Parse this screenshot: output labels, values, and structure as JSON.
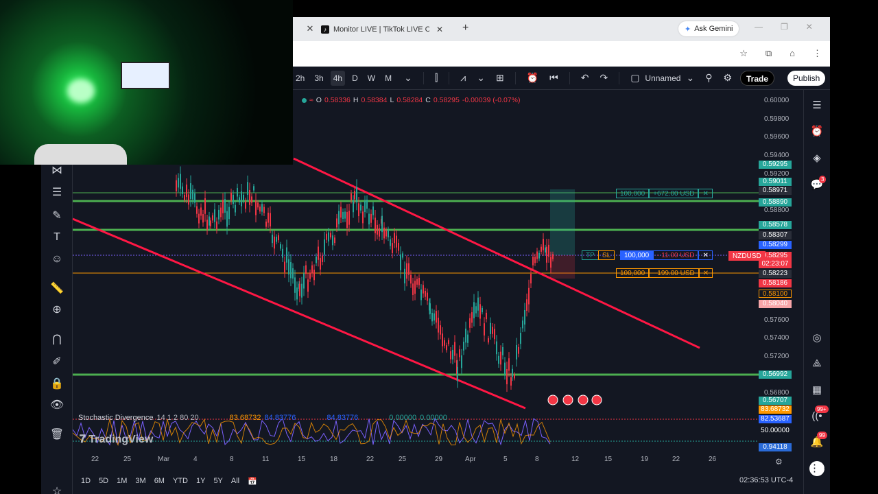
{
  "browser": {
    "tab_title": "Monitor LIVE | TikTok LIVE Cent",
    "gemini_label": "Ask Gemini"
  },
  "toolbar": {
    "intervals": [
      "2h",
      "3h",
      "4h",
      "D",
      "W",
      "M"
    ],
    "active_interval": "4h",
    "layout_name": "Unnamed",
    "trade_label": "Trade",
    "publish_label": "Publish"
  },
  "ohlc": {
    "open_label": "O",
    "open": "0.58336",
    "high_label": "H",
    "high": "0.58384",
    "low_label": "L",
    "low": "0.58284",
    "close_label": "C",
    "close": "0.58295",
    "change": "-0.00039 (-0.07%)"
  },
  "price_scale": [
    "0.60000",
    "0.59800",
    "0.59600",
    "0.59400",
    "0.59200",
    "0.58800",
    "0.57600",
    "0.57400",
    "0.57200",
    "0.56800"
  ],
  "price_tags": [
    {
      "value": "0.59295",
      "color": "#26a69a"
    },
    {
      "value": "0.59011",
      "color": "#26a69a"
    },
    {
      "value": "0.58971",
      "color": "#2a2e39"
    },
    {
      "value": "0.58890",
      "color": "#26a69a"
    },
    {
      "value": "0.58578",
      "color": "#26a69a"
    },
    {
      "value": "0.58307",
      "color": "#2a2e39"
    },
    {
      "value": "0.58299",
      "color": "#2962ff"
    },
    {
      "value": "0.58295",
      "color": "#f23645"
    },
    {
      "value": "02:23:07",
      "color": "#f23645"
    },
    {
      "value": "0.58223",
      "color": "#2a2e39"
    },
    {
      "value": "0.58186",
      "color": "#f23645"
    },
    {
      "value": "0.58100",
      "color": "#131722"
    },
    {
      "value": "0.58040",
      "color": "#f7a5a8"
    },
    {
      "value": "0.56992",
      "color": "#26a69a"
    },
    {
      "value": "0.56707",
      "color": "#26a69a"
    }
  ],
  "symbol_tag": "NZDUSD",
  "positions": [
    {
      "qty": "100,000",
      "pnl": "+672.00 USD",
      "color": "#26a69a"
    },
    {
      "qty": "100,000",
      "pnl": "- 11.00 USD",
      "color": "#2962ff"
    },
    {
      "qty": "100,000",
      "pnl": "- 199.00 USD",
      "color": "#ff9800"
    }
  ],
  "tp_label": "TP",
  "sl_label": "SL",
  "stochastic": {
    "name": "Stochastic Divergence",
    "params": "14 1 2 80 20",
    "v1": "83.68732",
    "v2": "84.83776",
    "v3": "84.83776",
    "v4": "0.00000",
    "v5": "0.00000",
    "scale_top": "83.68732",
    "scale_current": "82.53687",
    "scale_mid": "50.00000",
    "scale_low": "0.94118"
  },
  "watermark": "TradingView",
  "date_axis": [
    "22",
    "25",
    "Mar",
    "4",
    "8",
    "11",
    "15",
    "18",
    "22",
    "25",
    "29",
    "Apr",
    "5",
    "8",
    "12",
    "15",
    "19",
    "22",
    "26"
  ],
  "ranges": [
    "1D",
    "5D",
    "1M",
    "3M",
    "6M",
    "YTD",
    "1Y",
    "5Y",
    "All"
  ],
  "clock": "02:36:53 UTC-4",
  "badges": {
    "alerts": "3",
    "notif1": "99+",
    "notif2": "99"
  },
  "colors": {
    "bg": "#131722",
    "up": "#26a69a",
    "down": "#f23645",
    "channel": "#ff1744",
    "level": "#4caf50"
  }
}
